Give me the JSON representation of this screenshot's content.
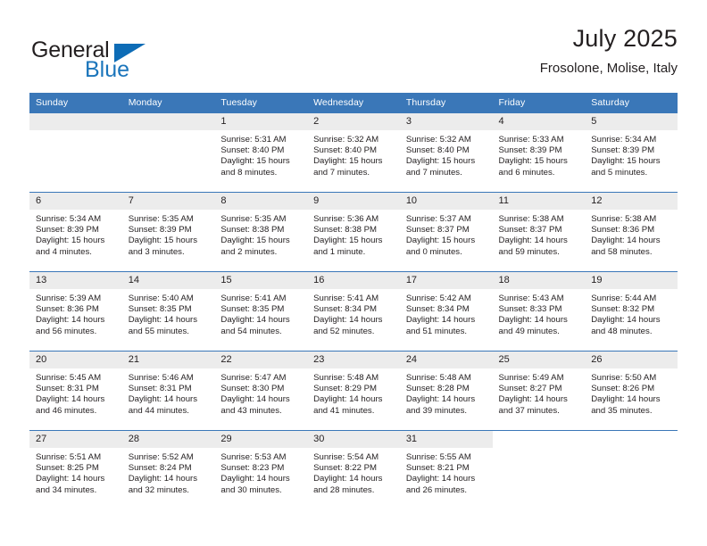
{
  "brand": {
    "name_top": "General",
    "name_bottom": "Blue",
    "triangle_color": "#0d6cb6",
    "blue_text_color": "#1b75bb"
  },
  "header": {
    "title": "July 2025",
    "subtitle": "Frosolone, Molise, Italy"
  },
  "theme": {
    "header_blue": "#3a77b8",
    "daynum_gray": "#ececec",
    "text": "#231f20"
  },
  "weekday_headers": [
    "Sunday",
    "Monday",
    "Tuesday",
    "Wednesday",
    "Thursday",
    "Friday",
    "Saturday"
  ],
  "weeks": [
    [
      {
        "day": "",
        "sunrise": "",
        "sunset": "",
        "daylight1": "",
        "daylight2": "",
        "empty": true
      },
      {
        "day": "",
        "sunrise": "",
        "sunset": "",
        "daylight1": "",
        "daylight2": "",
        "empty": true
      },
      {
        "day": "1",
        "sunrise": "Sunrise: 5:31 AM",
        "sunset": "Sunset: 8:40 PM",
        "daylight1": "Daylight: 15 hours",
        "daylight2": "and 8 minutes."
      },
      {
        "day": "2",
        "sunrise": "Sunrise: 5:32 AM",
        "sunset": "Sunset: 8:40 PM",
        "daylight1": "Daylight: 15 hours",
        "daylight2": "and 7 minutes."
      },
      {
        "day": "3",
        "sunrise": "Sunrise: 5:32 AM",
        "sunset": "Sunset: 8:40 PM",
        "daylight1": "Daylight: 15 hours",
        "daylight2": "and 7 minutes."
      },
      {
        "day": "4",
        "sunrise": "Sunrise: 5:33 AM",
        "sunset": "Sunset: 8:39 PM",
        "daylight1": "Daylight: 15 hours",
        "daylight2": "and 6 minutes."
      },
      {
        "day": "5",
        "sunrise": "Sunrise: 5:34 AM",
        "sunset": "Sunset: 8:39 PM",
        "daylight1": "Daylight: 15 hours",
        "daylight2": "and 5 minutes."
      }
    ],
    [
      {
        "day": "6",
        "sunrise": "Sunrise: 5:34 AM",
        "sunset": "Sunset: 8:39 PM",
        "daylight1": "Daylight: 15 hours",
        "daylight2": "and 4 minutes."
      },
      {
        "day": "7",
        "sunrise": "Sunrise: 5:35 AM",
        "sunset": "Sunset: 8:39 PM",
        "daylight1": "Daylight: 15 hours",
        "daylight2": "and 3 minutes."
      },
      {
        "day": "8",
        "sunrise": "Sunrise: 5:35 AM",
        "sunset": "Sunset: 8:38 PM",
        "daylight1": "Daylight: 15 hours",
        "daylight2": "and 2 minutes."
      },
      {
        "day": "9",
        "sunrise": "Sunrise: 5:36 AM",
        "sunset": "Sunset: 8:38 PM",
        "daylight1": "Daylight: 15 hours",
        "daylight2": "and 1 minute."
      },
      {
        "day": "10",
        "sunrise": "Sunrise: 5:37 AM",
        "sunset": "Sunset: 8:37 PM",
        "daylight1": "Daylight: 15 hours",
        "daylight2": "and 0 minutes."
      },
      {
        "day": "11",
        "sunrise": "Sunrise: 5:38 AM",
        "sunset": "Sunset: 8:37 PM",
        "daylight1": "Daylight: 14 hours",
        "daylight2": "and 59 minutes."
      },
      {
        "day": "12",
        "sunrise": "Sunrise: 5:38 AM",
        "sunset": "Sunset: 8:36 PM",
        "daylight1": "Daylight: 14 hours",
        "daylight2": "and 58 minutes."
      }
    ],
    [
      {
        "day": "13",
        "sunrise": "Sunrise: 5:39 AM",
        "sunset": "Sunset: 8:36 PM",
        "daylight1": "Daylight: 14 hours",
        "daylight2": "and 56 minutes."
      },
      {
        "day": "14",
        "sunrise": "Sunrise: 5:40 AM",
        "sunset": "Sunset: 8:35 PM",
        "daylight1": "Daylight: 14 hours",
        "daylight2": "and 55 minutes."
      },
      {
        "day": "15",
        "sunrise": "Sunrise: 5:41 AM",
        "sunset": "Sunset: 8:35 PM",
        "daylight1": "Daylight: 14 hours",
        "daylight2": "and 54 minutes."
      },
      {
        "day": "16",
        "sunrise": "Sunrise: 5:41 AM",
        "sunset": "Sunset: 8:34 PM",
        "daylight1": "Daylight: 14 hours",
        "daylight2": "and 52 minutes."
      },
      {
        "day": "17",
        "sunrise": "Sunrise: 5:42 AM",
        "sunset": "Sunset: 8:34 PM",
        "daylight1": "Daylight: 14 hours",
        "daylight2": "and 51 minutes."
      },
      {
        "day": "18",
        "sunrise": "Sunrise: 5:43 AM",
        "sunset": "Sunset: 8:33 PM",
        "daylight1": "Daylight: 14 hours",
        "daylight2": "and 49 minutes."
      },
      {
        "day": "19",
        "sunrise": "Sunrise: 5:44 AM",
        "sunset": "Sunset: 8:32 PM",
        "daylight1": "Daylight: 14 hours",
        "daylight2": "and 48 minutes."
      }
    ],
    [
      {
        "day": "20",
        "sunrise": "Sunrise: 5:45 AM",
        "sunset": "Sunset: 8:31 PM",
        "daylight1": "Daylight: 14 hours",
        "daylight2": "and 46 minutes."
      },
      {
        "day": "21",
        "sunrise": "Sunrise: 5:46 AM",
        "sunset": "Sunset: 8:31 PM",
        "daylight1": "Daylight: 14 hours",
        "daylight2": "and 44 minutes."
      },
      {
        "day": "22",
        "sunrise": "Sunrise: 5:47 AM",
        "sunset": "Sunset: 8:30 PM",
        "daylight1": "Daylight: 14 hours",
        "daylight2": "and 43 minutes."
      },
      {
        "day": "23",
        "sunrise": "Sunrise: 5:48 AM",
        "sunset": "Sunset: 8:29 PM",
        "daylight1": "Daylight: 14 hours",
        "daylight2": "and 41 minutes."
      },
      {
        "day": "24",
        "sunrise": "Sunrise: 5:48 AM",
        "sunset": "Sunset: 8:28 PM",
        "daylight1": "Daylight: 14 hours",
        "daylight2": "and 39 minutes."
      },
      {
        "day": "25",
        "sunrise": "Sunrise: 5:49 AM",
        "sunset": "Sunset: 8:27 PM",
        "daylight1": "Daylight: 14 hours",
        "daylight2": "and 37 minutes."
      },
      {
        "day": "26",
        "sunrise": "Sunrise: 5:50 AM",
        "sunset": "Sunset: 8:26 PM",
        "daylight1": "Daylight: 14 hours",
        "daylight2": "and 35 minutes."
      }
    ],
    [
      {
        "day": "27",
        "sunrise": "Sunrise: 5:51 AM",
        "sunset": "Sunset: 8:25 PM",
        "daylight1": "Daylight: 14 hours",
        "daylight2": "and 34 minutes."
      },
      {
        "day": "28",
        "sunrise": "Sunrise: 5:52 AM",
        "sunset": "Sunset: 8:24 PM",
        "daylight1": "Daylight: 14 hours",
        "daylight2": "and 32 minutes."
      },
      {
        "day": "29",
        "sunrise": "Sunrise: 5:53 AM",
        "sunset": "Sunset: 8:23 PM",
        "daylight1": "Daylight: 14 hours",
        "daylight2": "and 30 minutes."
      },
      {
        "day": "30",
        "sunrise": "Sunrise: 5:54 AM",
        "sunset": "Sunset: 8:22 PM",
        "daylight1": "Daylight: 14 hours",
        "daylight2": "and 28 minutes."
      },
      {
        "day": "31",
        "sunrise": "Sunrise: 5:55 AM",
        "sunset": "Sunset: 8:21 PM",
        "daylight1": "Daylight: 14 hours",
        "daylight2": "and 26 minutes."
      },
      {
        "day": "",
        "sunrise": "",
        "sunset": "",
        "daylight1": "",
        "daylight2": "",
        "blank": true
      },
      {
        "day": "",
        "sunrise": "",
        "sunset": "",
        "daylight1": "",
        "daylight2": "",
        "blank": true
      }
    ]
  ]
}
